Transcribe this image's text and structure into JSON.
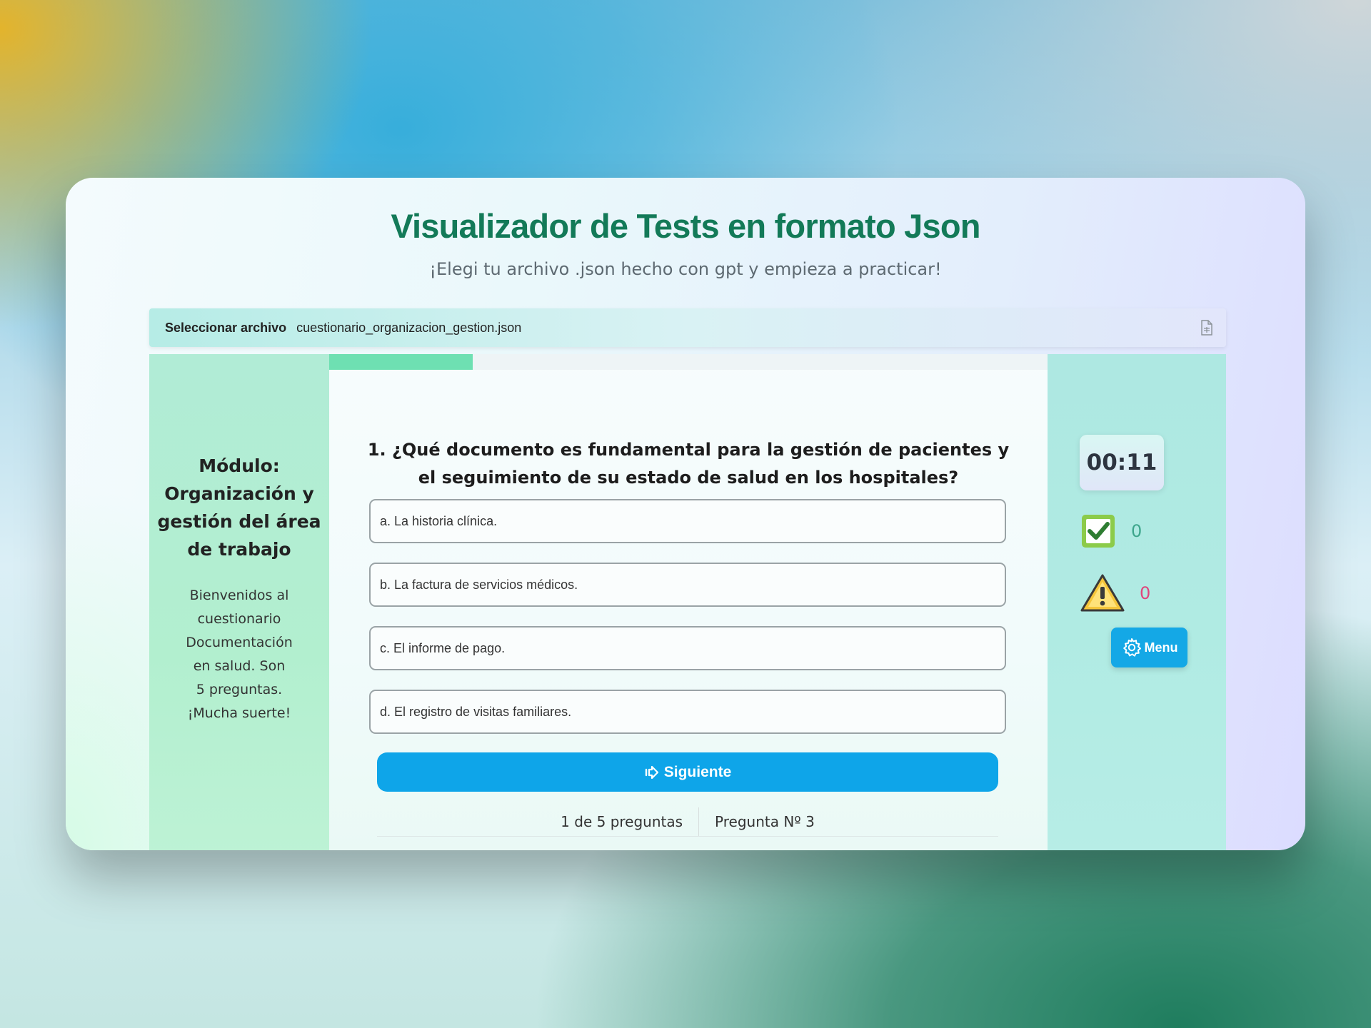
{
  "header": {
    "title": "Visualizador de Tests en formato Json",
    "subtitle": "¡Elegi tu archivo .json hecho con gpt y empieza a practicar!"
  },
  "file_input": {
    "button_label": "Seleccionar archivo",
    "file_name": "cuestionario_organizacion_gestion.json",
    "icon": "file-icon"
  },
  "progress": {
    "fraction": 0.2
  },
  "sidebar": {
    "module_title_lines": [
      "Módulo:",
      "Organización y",
      "gestión del área",
      "de trabajo"
    ],
    "welcome_lines": [
      "Bienvenidos al",
      "cuestionario",
      "Documentación",
      "en salud. Son",
      "5 preguntas.",
      "¡Mucha suerte!"
    ]
  },
  "question": {
    "text": "1. ¿Qué documento es fundamental para la gestión de pacientes y el seguimiento de su estado de salud en los hospitales?",
    "options": [
      "a. La historia clínica.",
      "b. La factura de servicios médicos.",
      "c. El informe de pago.",
      "d. El registro de visitas familiares."
    ]
  },
  "next_button": {
    "label": "Siguiente",
    "icon": "arrow-right-icon"
  },
  "footer": {
    "count": "1 de 5 preguntas",
    "question_number": "Pregunta Nº 3"
  },
  "stats": {
    "timer": "00:11",
    "correct": "0",
    "wrong": "0",
    "correct_icon": "checkbox-check-icon",
    "wrong_icon": "warning-icon"
  },
  "menu_button": {
    "label": "Menu",
    "icon": "gear-icon"
  },
  "colors": {
    "title": "#137a58",
    "accent_blue": "#0ea5e9",
    "progress": "#6ee0b2",
    "correct": "#3da68c",
    "wrong": "#e0457b"
  }
}
